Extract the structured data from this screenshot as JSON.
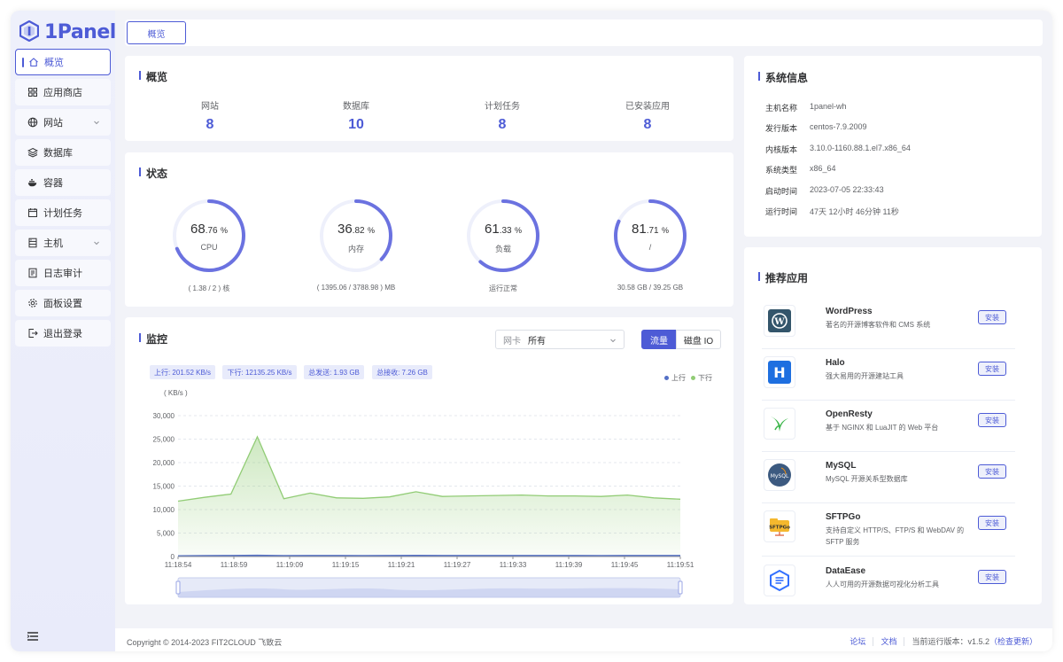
{
  "app": {
    "logo_text": "1Panel"
  },
  "sidebar": {
    "items": [
      {
        "label": "概览",
        "icon": "home-icon"
      },
      {
        "label": "应用商店",
        "icon": "grid-icon"
      },
      {
        "label": "网站",
        "icon": "globe-icon"
      },
      {
        "label": "数据库",
        "icon": "layers-icon"
      },
      {
        "label": "容器",
        "icon": "docker-icon"
      },
      {
        "label": "计划任务",
        "icon": "calendar-icon"
      },
      {
        "label": "主机",
        "icon": "server-icon"
      },
      {
        "label": "日志审计",
        "icon": "log-icon"
      },
      {
        "label": "面板设置",
        "icon": "gear-icon"
      },
      {
        "label": "退出登录",
        "icon": "logout-icon"
      }
    ]
  },
  "tabs": [
    {
      "label": "概览"
    }
  ],
  "overview": {
    "title": "概览",
    "items": [
      {
        "label": "网站",
        "value": "8"
      },
      {
        "label": "数据库",
        "value": "10"
      },
      {
        "label": "计划任务",
        "value": "8"
      },
      {
        "label": "已安装应用",
        "value": "8"
      }
    ]
  },
  "status": {
    "title": "状态",
    "gauges": [
      {
        "int": "68",
        "dec": ".76",
        "pct": "%",
        "name": "CPU",
        "percent": 68.76,
        "detail": "( 1.38 / 2 ) 核"
      },
      {
        "int": "36",
        "dec": ".82",
        "pct": "%",
        "name": "内存",
        "percent": 36.82,
        "detail": "( 1395.06 / 3788.98 ) MB"
      },
      {
        "int": "61",
        "dec": ".33",
        "pct": "%",
        "name": "负载",
        "percent": 61.33,
        "detail": "运行正常"
      },
      {
        "int": "81",
        "dec": ".71",
        "pct": "%",
        "name": "/",
        "percent": 81.71,
        "detail": "30.58 GB / 39.25 GB"
      }
    ]
  },
  "monitor": {
    "title": "监控",
    "nic_label": "网卡",
    "nic_value": "所有",
    "btn_traffic": "流量",
    "btn_disk": "磁盘 IO",
    "stats": [
      "上行: 201.52 KB/s",
      "下行: 12135.25 KB/s",
      "总发送: 1.93 GB",
      "总接收: 7.26 GB"
    ],
    "legend_up": "上行",
    "legend_down": "下行",
    "unit": "( KB/s )"
  },
  "chart_data": {
    "type": "area",
    "ylabel": "( KB/s )",
    "ylim": [
      0,
      30000
    ],
    "yticks": [
      "30,000",
      "25,000",
      "20,000",
      "15,000",
      "10,000",
      "5,000",
      "0"
    ],
    "xticks": [
      "11:18:54",
      "11:18:59",
      "11:19:09",
      "11:19:15",
      "11:19:21",
      "11:19:27",
      "11:19:33",
      "11:19:39",
      "11:19:45",
      "11:19:51"
    ],
    "series": [
      {
        "name": "下行",
        "color": "#91cc75",
        "values": [
          11800,
          12600,
          13300,
          25500,
          12300,
          13500,
          12500,
          12400,
          12700,
          13800,
          12800,
          12900,
          13000,
          13100,
          12900,
          12900,
          12800,
          13100,
          12500,
          12200
        ]
      },
      {
        "name": "上行",
        "color": "#5470c6",
        "values": [
          150,
          180,
          200,
          260,
          190,
          210,
          200,
          190,
          200,
          220,
          200,
          200,
          210,
          200,
          200,
          200,
          190,
          210,
          200,
          200
        ]
      }
    ],
    "grid": true,
    "legend": "top-right"
  },
  "sysinfo": {
    "title": "系统信息",
    "rows": [
      {
        "key": "主机名称",
        "value": "1panel-wh"
      },
      {
        "key": "发行版本",
        "value": "centos-7.9.2009"
      },
      {
        "key": "内核版本",
        "value": "3.10.0-1160.88.1.el7.x86_64"
      },
      {
        "key": "系统类型",
        "value": "x86_64"
      },
      {
        "key": "启动时间",
        "value": "2023-07-05 22:33:43"
      },
      {
        "key": "运行时间",
        "value": "47天 12小时 46分钟 11秒"
      }
    ]
  },
  "apps": {
    "title": "推荐应用",
    "install_label": "安装",
    "items": [
      {
        "name": "WordPress",
        "desc": "著名的开源博客软件和 CMS 系统",
        "icon": "wordpress-icon"
      },
      {
        "name": "Halo",
        "desc": "强大易用的开源建站工具",
        "icon": "halo-icon"
      },
      {
        "name": "OpenResty",
        "desc": "基于 NGINX 和 LuaJIT 的 Web 平台",
        "icon": "openresty-icon"
      },
      {
        "name": "MySQL",
        "desc": "MySQL 开源关系型数据库",
        "icon": "mysql-icon"
      },
      {
        "name": "SFTPGo",
        "desc": "支持自定义 HTTP/S、FTP/S 和 WebDAV 的 SFTP 服务",
        "icon": "sftpgo-icon"
      },
      {
        "name": "DataEase",
        "desc": "人人可用的开源数据可视化分析工具",
        "icon": "dataease-icon"
      }
    ]
  },
  "footer": {
    "copyright": "Copyright © 2014-2023 FIT2CLOUD 飞致云",
    "forum": "论坛",
    "docs": "文档",
    "version_label": "当前运行版本：v1.5.2",
    "check_update": "（检查更新）"
  }
}
